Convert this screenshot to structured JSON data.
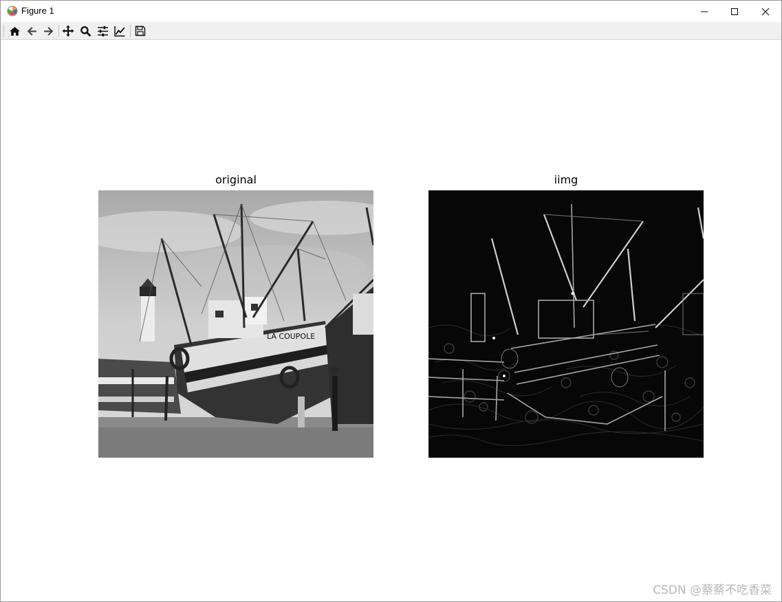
{
  "window": {
    "title": "Figure 1"
  },
  "toolbar": {
    "items": [
      {
        "name": "home-icon"
      },
      {
        "name": "back-arrow-icon"
      },
      {
        "name": "forward-arrow-icon"
      },
      {
        "name": "pan-icon"
      },
      {
        "name": "zoom-icon"
      },
      {
        "name": "configure-subplots-icon"
      },
      {
        "name": "edit-axes-icon"
      },
      {
        "name": "save-icon"
      }
    ]
  },
  "figure": {
    "subplots": [
      {
        "title": "original",
        "image": "grayscale photograph of fishing boats on a beach with a lighthouse"
      },
      {
        "title": "iimg",
        "image": "dark high-pass filtered edge image of the same boat scene"
      }
    ]
  },
  "watermark": "CSDN @蔡蔡不吃香菜"
}
